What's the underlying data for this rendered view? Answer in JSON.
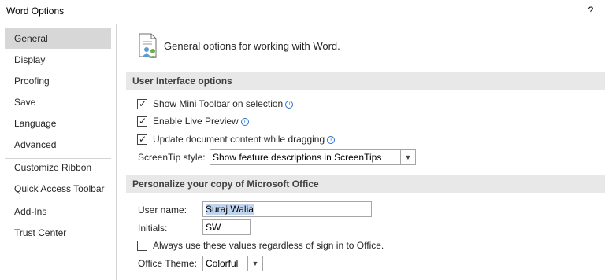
{
  "window": {
    "title": "Word Options",
    "help": "?"
  },
  "sidebar": {
    "items": [
      {
        "label": "General",
        "selected": true
      },
      {
        "label": "Display"
      },
      {
        "label": "Proofing"
      },
      {
        "label": "Save"
      },
      {
        "label": "Language"
      },
      {
        "label": "Advanced"
      },
      {
        "label": "Customize Ribbon"
      },
      {
        "label": "Quick Access Toolbar"
      },
      {
        "label": "Add-Ins"
      },
      {
        "label": "Trust Center"
      }
    ]
  },
  "main": {
    "intro_icon": "general-options-icon",
    "intro": "General options for working with Word.",
    "ui_section": {
      "title": "User Interface options",
      "options": [
        {
          "label": "Show Mini Toolbar on selection",
          "checked": true,
          "info": true
        },
        {
          "label": "Enable Live Preview",
          "checked": true,
          "info": true
        },
        {
          "label": "Update document content while dragging",
          "checked": true,
          "info": true
        }
      ],
      "screentip_label": "ScreenTip style:",
      "screentip_value": "Show feature descriptions in ScreenTips"
    },
    "personalize_section": {
      "title": "Personalize your copy of Microsoft Office",
      "username_label": "User name:",
      "username_value": "Suraj Walia",
      "initials_label": "Initials:",
      "initials_value": "SW",
      "always_use_label": "Always use these values regardless of sign in to Office.",
      "always_use_checked": false,
      "theme_label": "Office Theme:",
      "theme_value": "Colorful"
    }
  },
  "colors": {
    "selected_nav": "#d7d7d7",
    "section_bg": "#e8e8e8",
    "info_blue": "#2b70c9",
    "text_selection": "#c0d4ee"
  }
}
